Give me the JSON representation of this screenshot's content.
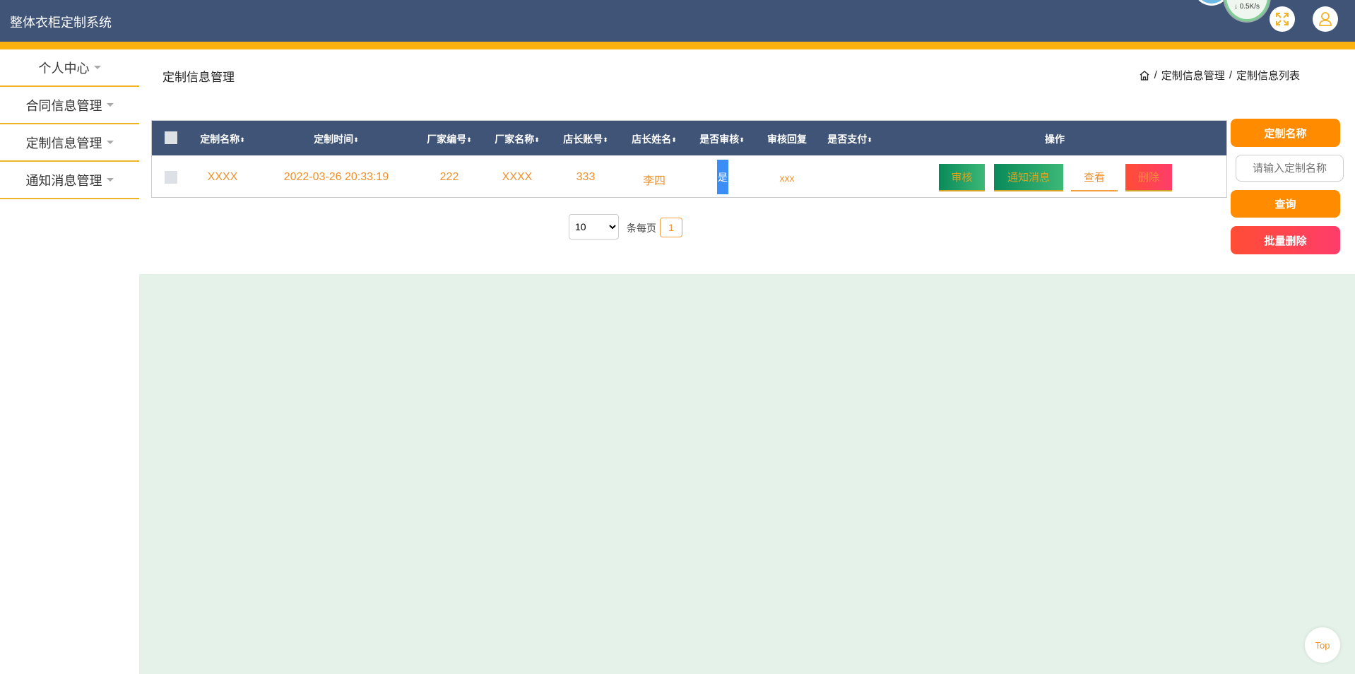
{
  "app": {
    "title": "整体衣柜定制系统",
    "net_speed": "↓ 0.5K/s"
  },
  "sidebar": {
    "items": [
      {
        "label": "个人中心"
      },
      {
        "label": "合同信息管理"
      },
      {
        "label": "定制信息管理"
      },
      {
        "label": "通知消息管理"
      }
    ]
  },
  "page": {
    "title": "定制信息管理",
    "breadcrumb": [
      "定制信息管理",
      "定制信息列表"
    ],
    "sep": "/"
  },
  "table": {
    "headers": [
      "定制名称",
      "定制时间",
      "厂家编号",
      "厂家名称",
      "店长账号",
      "店长姓名",
      "是否审核",
      "审核回复",
      "是否支付",
      "操作"
    ],
    "sort_icon": "⬍",
    "rows": [
      {
        "name": "XXXX",
        "time": "2022-03-26 20:33:19",
        "factory_no": "222",
        "factory_name": "XXXX",
        "manager_account": "333",
        "manager_name": "李四",
        "reviewed": "是",
        "reply": "xxx",
        "paid": ""
      }
    ],
    "actions": {
      "review": "审核",
      "notify": "通知消息",
      "view": "查看",
      "delete": "删除"
    }
  },
  "pagination": {
    "page_size": "10",
    "per_page_label": "条每页",
    "current_page": "1"
  },
  "search": {
    "field_label": "定制名称",
    "placeholder": "请输入定制名称",
    "query": "查询",
    "batch_delete": "批量删除"
  },
  "top_button": "Top"
}
